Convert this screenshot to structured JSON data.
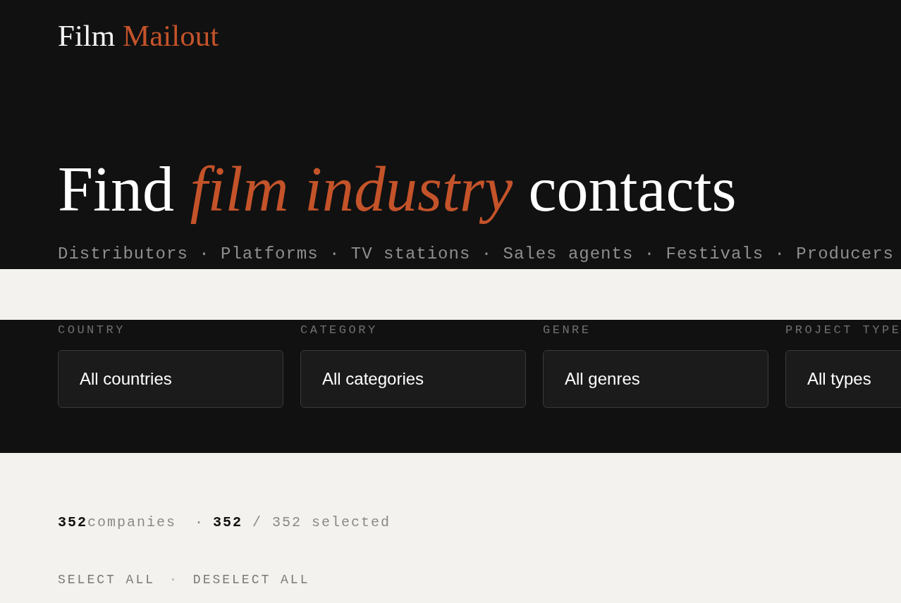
{
  "logo": {
    "text": "Film",
    "accent": "Mailout"
  },
  "hero": {
    "title": "Find *film industry* contacts",
    "subtitle": "Distributors · Platforms · TV stations · Sales agents · Festivals · Producers"
  },
  "filters": [
    {
      "label": "COUNTRY",
      "value": "All countries"
    },
    {
      "label": "CATEGORY",
      "value": "All categories"
    },
    {
      "label": "GENRE",
      "value": "All genres"
    },
    {
      "label": "PROJECT TYPE",
      "value": "All types"
    }
  ],
  "summary": {
    "companies": "**352**companies",
    "separator": "·",
    "selected": "**352** / 352 selected"
  },
  "actions": [
    {
      "label": "SELECT ALL"
    },
    {
      "label": "DESELECT ALL"
    }
  ],
  "actions_separator": "·"
}
